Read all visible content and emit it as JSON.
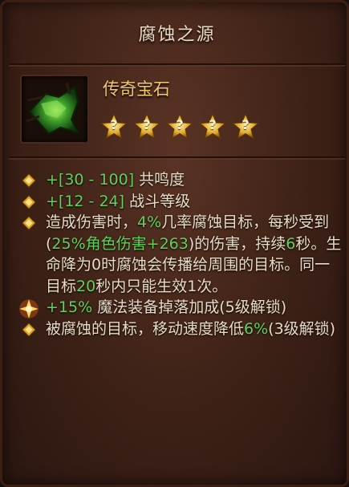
{
  "item": {
    "name": "腐蚀之源",
    "type": "传奇宝石",
    "star_slots": [
      "?",
      "?",
      "?",
      "?",
      "?"
    ]
  },
  "affixes": [
    {
      "segments": [
        {
          "t": "+[30 - 100]",
          "g": true
        },
        {
          "t": " 共鸣度",
          "g": false
        }
      ]
    },
    {
      "segments": [
        {
          "t": "+[12 - 24]",
          "g": true
        },
        {
          "t": " 战斗等级",
          "g": false
        }
      ]
    },
    {
      "segments": [
        {
          "t": "造成伤害时，",
          "g": false
        },
        {
          "t": "4%",
          "g": true
        },
        {
          "t": "几率腐蚀目标，每秒受到(",
          "g": false
        },
        {
          "t": "25%",
          "g": true
        },
        {
          "t": "角色伤害",
          "g": true
        },
        {
          "t": "+263",
          "g": true
        },
        {
          "t": ")的伤害，持续",
          "g": false
        },
        {
          "t": "6",
          "g": true
        },
        {
          "t": "秒。生命降为0时腐蚀会传播给周围的目标。同一目标",
          "g": false
        },
        {
          "t": "20",
          "g": true
        },
        {
          "t": "秒内只能生效1次。",
          "g": false
        }
      ]
    },
    {
      "bullet": "big",
      "segments": [
        {
          "t": "+15%",
          "g": true
        },
        {
          "t": " 魔法装备掉落加成(5级解锁)",
          "g": false
        }
      ]
    },
    {
      "segments": [
        {
          "t": "被腐蚀的目标，移动速度降低",
          "g": false
        },
        {
          "t": "6%",
          "g": true
        },
        {
          "t": "(3级解锁)",
          "g": false
        }
      ]
    }
  ],
  "colors": {
    "green": "#62d15a",
    "gold": "#f0c86a",
    "text": "#e8dcc6"
  }
}
